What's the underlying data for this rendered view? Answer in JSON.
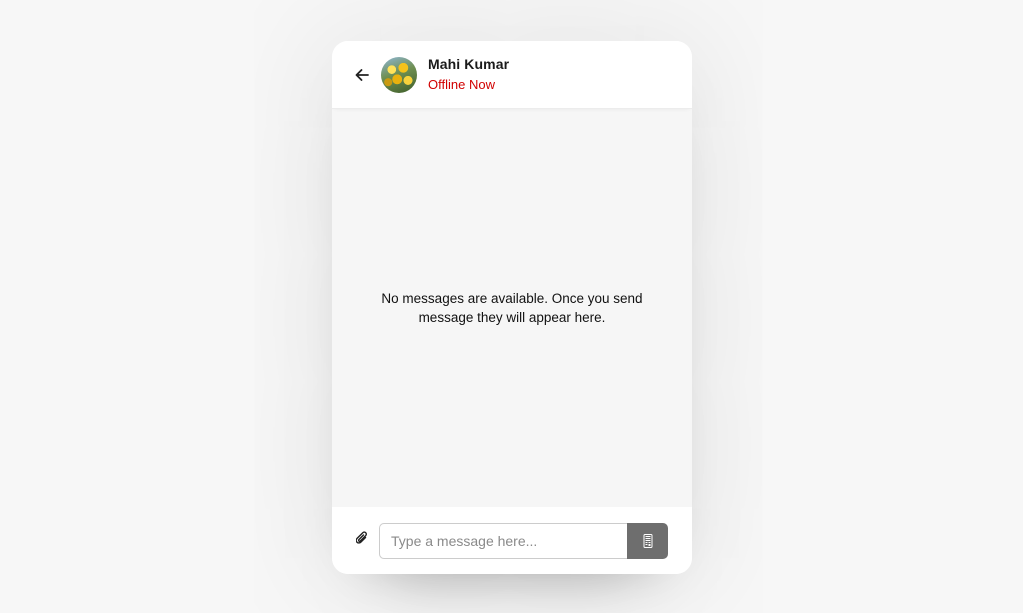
{
  "header": {
    "back_icon": "arrow-left-icon",
    "contact_name": "Mahi Kumar",
    "status": "Offline Now",
    "status_color": "#d10000"
  },
  "chat": {
    "empty_message": "No messages are available. Once you send message they will appear here."
  },
  "composer": {
    "attach_icon": "paperclip-icon",
    "input_placeholder": "Type a message here...",
    "input_value": "",
    "send_icon": "send-icon",
    "send_button_color": "#6e6e6e"
  }
}
